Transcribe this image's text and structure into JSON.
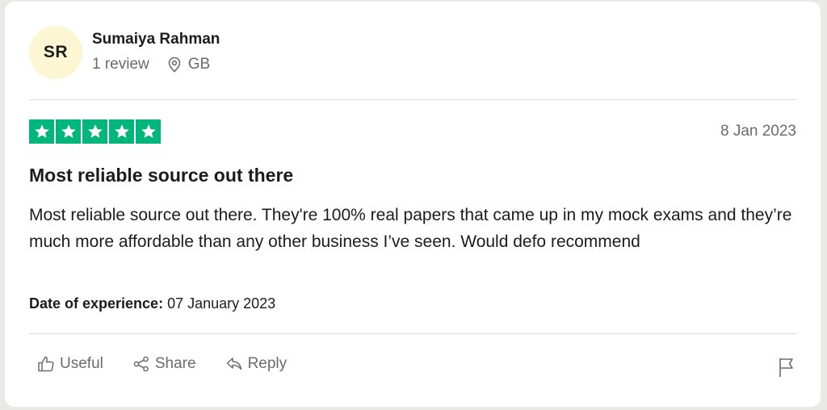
{
  "consumer": {
    "initials": "SR",
    "name": "Sumaiya Rahman",
    "reviews": "1 review",
    "location": "GB",
    "location_icon": "location-pin-icon",
    "avatar_color": "#fcf6d3"
  },
  "review": {
    "rating": 5,
    "max_rating": 5,
    "star_color": "#00b67a",
    "date": "8 Jan 2023",
    "title": "Most reliable source out there",
    "text": "Most reliable source out there. They're 100% real papers that came up in my mock exams and they’re much more affordable than any other business I’ve seen. Would defo recommend",
    "experience_label": "Date of experience:",
    "experience_date": "07 January 2023"
  },
  "actions": {
    "useful_label": "Useful",
    "useful_icon": "thumbs-up-icon",
    "share_label": "Share",
    "share_icon": "share-icon",
    "reply_label": "Reply",
    "reply_icon": "reply-icon",
    "flag_icon": "flag-icon"
  }
}
